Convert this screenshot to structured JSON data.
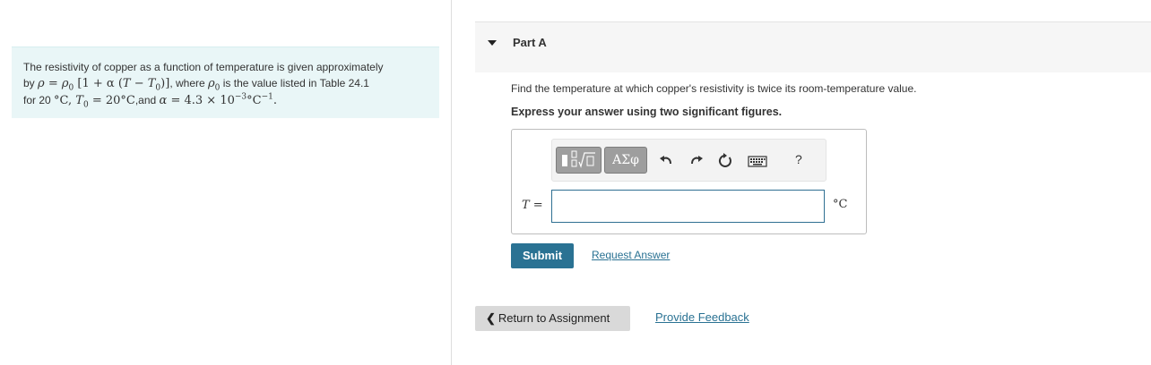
{
  "problem": {
    "line1": "The resistivity of copper as a function of temperature is given approximately",
    "line2_prefix": "by",
    "line2_where": ", where",
    "line2_suffix": "is the value listed in Table 24.1",
    "line3_for": "for 20",
    "line3_and": ",and",
    "math": {
      "rho": "ρ",
      "eq": "=",
      "rho0": "ρ",
      "sub0": "0",
      "bracket_open": "[1 + α (",
      "T": "T",
      "minus": "−",
      "T0": "T",
      "bracket_close": ")]",
      "deg_c": "°C",
      "T0_eq": "= 20°C",
      "alpha": "α",
      "alpha_val": "= 4.3 × 10",
      "exp": "−3",
      "unit_tail": "°C",
      "unit_exp": "−1",
      "period": "."
    }
  },
  "part": {
    "title": "Part A",
    "question": "Find the temperature at which copper's resistivity is twice its room-temperature value.",
    "instruction": "Express your answer using two significant figures."
  },
  "toolbar": {
    "greek_label": "ΑΣφ",
    "help_label": "?",
    "icons": [
      "templates-icon",
      "greek-letters-icon",
      "undo-icon",
      "redo-icon",
      "reset-icon",
      "keyboard-icon",
      "help-icon"
    ]
  },
  "answer": {
    "variable": "T",
    "equals": " =",
    "value": "",
    "unit": "°C"
  },
  "actions": {
    "submit": "Submit",
    "request": "Request Answer",
    "return": "Return to Assignment",
    "feedback": "Provide Feedback"
  },
  "colors": {
    "accent": "#2a7293",
    "problem_bg": "#e9f6f7",
    "toolbar_button": "#9e9e9e"
  }
}
